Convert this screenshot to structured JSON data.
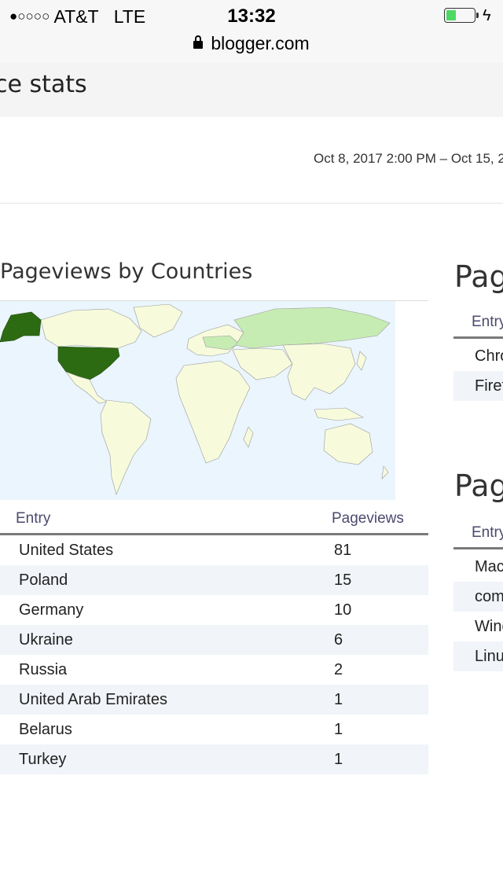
{
  "status_bar": {
    "signal_dots": "●○○○○",
    "carrier": "AT&T",
    "network": "LTE",
    "time": "13:32",
    "url": "blogger.com",
    "battery_level": 0.35
  },
  "page": {
    "title": "nce stats",
    "date_range": "Oct 8, 2017 2:00 PM – Oct 15, 2"
  },
  "countries": {
    "title": "Pageviews by Countries",
    "headers": [
      "Entry",
      "Pageviews"
    ],
    "rows": [
      {
        "entry": "United States",
        "pageviews": "81"
      },
      {
        "entry": "Poland",
        "pageviews": "15"
      },
      {
        "entry": "Germany",
        "pageviews": "10"
      },
      {
        "entry": "Ukraine",
        "pageviews": "6"
      },
      {
        "entry": "Russia",
        "pageviews": "2"
      },
      {
        "entry": "United Arab Emirates",
        "pageviews": "1"
      },
      {
        "entry": "Belarus",
        "pageviews": "1"
      },
      {
        "entry": "Turkey",
        "pageviews": "1"
      }
    ]
  },
  "browsers": {
    "title": "Pag",
    "header": "Entry",
    "rows": [
      "Chrome",
      "Firefox"
    ]
  },
  "os": {
    "title": "Pag",
    "header": "Entry",
    "rows": [
      "Macintosh",
      "com",
      "Windows",
      "Linux"
    ]
  },
  "colors": {
    "map_high": "#2d6b12",
    "map_mid": "#c7ecb3",
    "map_low": "#f7fbdc",
    "map_water": "#eaf5fd"
  }
}
